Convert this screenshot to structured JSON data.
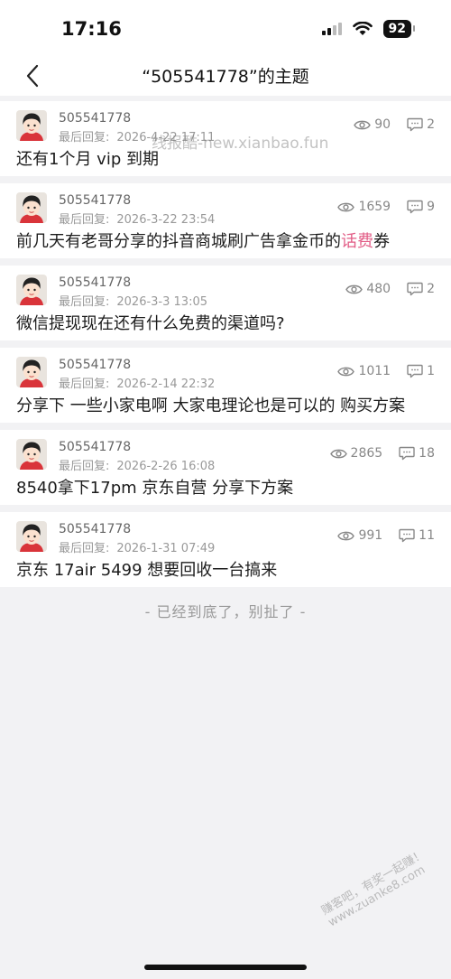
{
  "status": {
    "time": "17:16",
    "battery": "92"
  },
  "nav": {
    "title": "“505541778”的主题"
  },
  "watermark": "线报酷-new.xianbao.fun",
  "watermark_corner": "赚客吧，有奖一起赚！www.zuanke8.com",
  "posts": [
    {
      "author": "505541778",
      "reply_label": "最后回复:",
      "reply_time": "2026-4-22 17:11",
      "views": "90",
      "comments": "2",
      "title": "还有1个月 vip 到期"
    },
    {
      "author": "505541778",
      "reply_label": "最后回复:",
      "reply_time": "2026-3-22 23:54",
      "views": "1659",
      "comments": "9",
      "title_a": "前几天有老哥分享的抖音商城刷广告拿金币的",
      "title_hl": "话费",
      "title_b": "券"
    },
    {
      "author": "505541778",
      "reply_label": "最后回复:",
      "reply_time": "2026-3-3 13:05",
      "views": "480",
      "comments": "2",
      "title": "微信提现现在还有什么免费的渠道吗?"
    },
    {
      "author": "505541778",
      "reply_label": "最后回复:",
      "reply_time": "2026-2-14 22:32",
      "views": "1011",
      "comments": "1",
      "title": "分享下 一些小家电啊 大家电理论也是可以的 购买方案"
    },
    {
      "author": "505541778",
      "reply_label": "最后回复:",
      "reply_time": "2026-2-26 16:08",
      "views": "2865",
      "comments": "18",
      "title": "8540拿下17pm 京东自营 分享下方案"
    },
    {
      "author": "505541778",
      "reply_label": "最后回复:",
      "reply_time": "2026-1-31 07:49",
      "views": "991",
      "comments": "11",
      "title": "京东 17air 5499 想要回收一台搞来"
    }
  ],
  "end_text": "- 已经到底了，别扯了 -",
  "icons": {
    "back": "chevron-left-icon",
    "views": "eye-icon",
    "comments": "comment-icon",
    "signal": "signal-icon",
    "wifi": "wifi-icon"
  },
  "colors": {
    "highlight": "#e25c86",
    "background": "#f2f2f4"
  }
}
